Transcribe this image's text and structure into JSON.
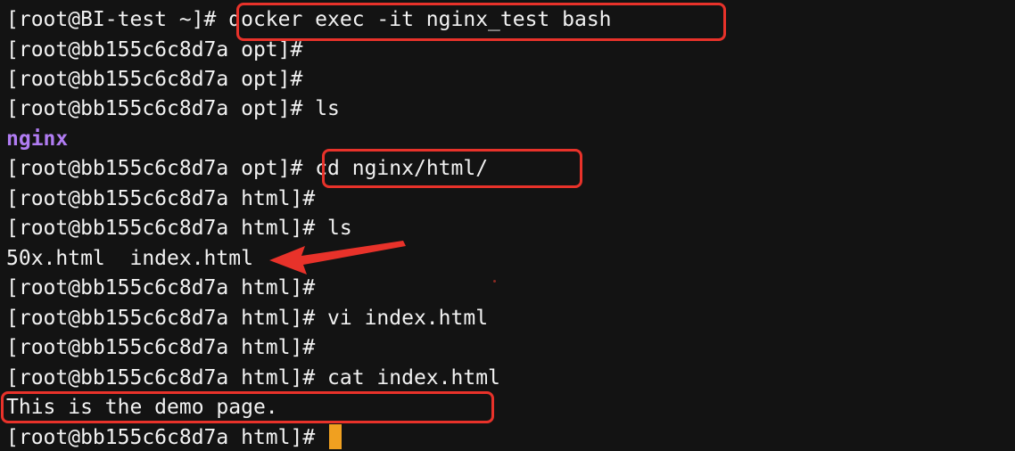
{
  "terminal": {
    "lines": [
      {
        "kind": "cmd",
        "prompt": "[root@BI-test ~]#",
        "command": " docker exec -it nginx_test bash"
      },
      {
        "kind": "cmd",
        "prompt": "[root@bb155c6c8d7a opt]#",
        "command": ""
      },
      {
        "kind": "cmd",
        "prompt": "[root@bb155c6c8d7a opt]#",
        "command": ""
      },
      {
        "kind": "cmd",
        "prompt": "[root@bb155c6c8d7a opt]#",
        "command": " ls"
      },
      {
        "kind": "dir",
        "text": "nginx"
      },
      {
        "kind": "cmd",
        "prompt": "[root@bb155c6c8d7a opt]#",
        "command": " cd nginx/html/"
      },
      {
        "kind": "cmd",
        "prompt": "[root@bb155c6c8d7a html]#",
        "command": ""
      },
      {
        "kind": "cmd",
        "prompt": "[root@bb155c6c8d7a html]#",
        "command": " ls"
      },
      {
        "kind": "out",
        "text": "50x.html  index.html"
      },
      {
        "kind": "cmd",
        "prompt": "[root@bb155c6c8d7a html]#",
        "command": ""
      },
      {
        "kind": "cmd",
        "prompt": "[root@bb155c6c8d7a html]#",
        "command": " vi index.html"
      },
      {
        "kind": "cmd",
        "prompt": "[root@bb155c6c8d7a html]#",
        "command": ""
      },
      {
        "kind": "cmd",
        "prompt": "[root@bb155c6c8d7a html]#",
        "command": " cat index.html"
      },
      {
        "kind": "out",
        "text": "This is the demo page."
      },
      {
        "kind": "cmd",
        "prompt": "[root@bb155c6c8d7a html]#",
        "command": ""
      }
    ]
  },
  "colors": {
    "background": "#131313",
    "text": "#f2f2f2",
    "directory": "#b07cf2",
    "annotation": "#e8322a",
    "cursor": "#f0a020"
  }
}
